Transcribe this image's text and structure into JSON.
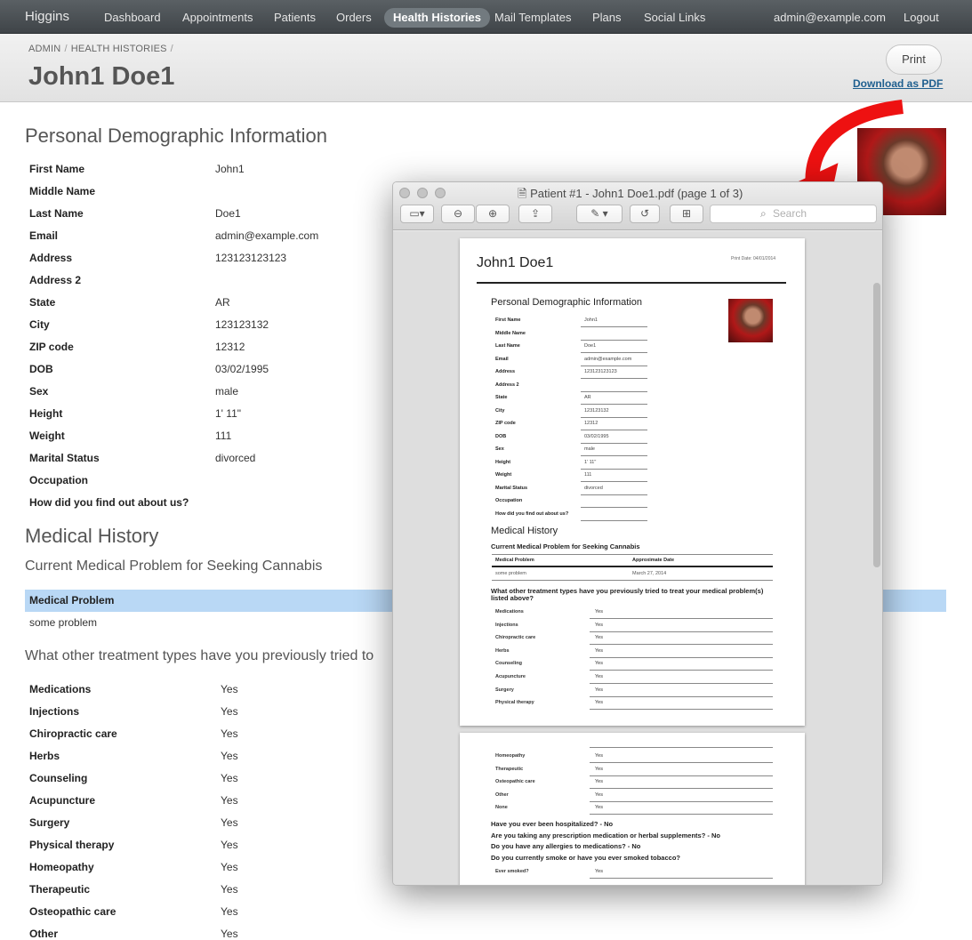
{
  "nav": {
    "brand": "Higgins",
    "items": [
      "Dashboard",
      "Appointments",
      "Patients",
      "Orders",
      "Health Histories",
      "Mail Templates",
      "Plans",
      "Social Links"
    ],
    "user": "admin@example.com",
    "logout": "Logout"
  },
  "header": {
    "breadcrumb": [
      "ADMIN",
      "HEALTH HISTORIES"
    ],
    "title": "John1 Doe1",
    "print": "Print",
    "download": "Download as PDF"
  },
  "demographics": {
    "heading": "Personal Demographic Information",
    "fields": [
      {
        "label": "First Name",
        "value": "John1"
      },
      {
        "label": "Middle Name",
        "value": ""
      },
      {
        "label": "Last Name",
        "value": "Doe1"
      },
      {
        "label": "Email",
        "value": "admin@example.com"
      },
      {
        "label": "Address",
        "value": "123123123123"
      },
      {
        "label": "Address 2",
        "value": ""
      },
      {
        "label": "State",
        "value": "AR"
      },
      {
        "label": "City",
        "value": "123123132"
      },
      {
        "label": "ZIP code",
        "value": "12312"
      },
      {
        "label": "DOB",
        "value": "03/02/1995"
      },
      {
        "label": "Sex",
        "value": "male"
      },
      {
        "label": "Height",
        "value": "1' 11\""
      },
      {
        "label": "Weight",
        "value": "111"
      },
      {
        "label": "Marital Status",
        "value": "divorced"
      },
      {
        "label": "Occupation",
        "value": ""
      },
      {
        "label": "How did you find out about us?",
        "value": ""
      }
    ]
  },
  "medical": {
    "heading": "Medical History",
    "current_problem_heading": "Current Medical Problem for Seeking Cannabis",
    "problem_col": "Medical Problem",
    "problem": "some problem",
    "treatments_heading": "What other treatment types have you previously tried to",
    "treatments": [
      {
        "label": "Medications",
        "value": "Yes"
      },
      {
        "label": "Injections",
        "value": "Yes"
      },
      {
        "label": "Chiropractic care",
        "value": "Yes"
      },
      {
        "label": "Herbs",
        "value": "Yes"
      },
      {
        "label": "Counseling",
        "value": "Yes"
      },
      {
        "label": "Acupuncture",
        "value": "Yes"
      },
      {
        "label": "Surgery",
        "value": "Yes"
      },
      {
        "label": "Physical therapy",
        "value": "Yes"
      },
      {
        "label": "Homeopathy",
        "value": "Yes"
      },
      {
        "label": "Therapeutic",
        "value": "Yes"
      },
      {
        "label": "Osteopathic care",
        "value": "Yes"
      },
      {
        "label": "Other",
        "value": "Yes"
      }
    ]
  },
  "preview": {
    "title": "Patient #1 - John1  Doe1.pdf (page 1 of 3)",
    "search_placeholder": "Search",
    "page1": {
      "title": "John1 Doe1",
      "print_date": "Print Date: 04/01/2014",
      "demo_heading": "Personal Demographic Information",
      "fields": [
        {
          "label": "First Name",
          "value": "John1"
        },
        {
          "label": "Middle Name",
          "value": ""
        },
        {
          "label": "Last Name",
          "value": "Doe1"
        },
        {
          "label": "Email",
          "value": "admin@example.com"
        },
        {
          "label": "Address",
          "value": "123123123123"
        },
        {
          "label": "Address 2",
          "value": ""
        },
        {
          "label": "State",
          "value": "AR"
        },
        {
          "label": "City",
          "value": "123123132"
        },
        {
          "label": "ZIP code",
          "value": "12312"
        },
        {
          "label": "DOB",
          "value": "03/02/1995"
        },
        {
          "label": "Sex",
          "value": "male"
        },
        {
          "label": "Height",
          "value": "1' 11\""
        },
        {
          "label": "Weight",
          "value": "111"
        },
        {
          "label": "Marital Status",
          "value": "divorced"
        },
        {
          "label": "Occupation",
          "value": ""
        },
        {
          "label": "How did you find out about us?",
          "value": ""
        }
      ],
      "med_heading": "Medical History",
      "current_heading": "Current Medical Problem for Seeking Cannabis",
      "col1": "Medical Problem",
      "col2": "Approximate Date",
      "problem": "some problem",
      "problem_date": "March 27, 2014",
      "treat_heading": "What other treatment types have you previously tried to treat your medical problem(s) listed above?",
      "treatments": [
        {
          "label": "Medications",
          "value": "Yes"
        },
        {
          "label": "Injections",
          "value": "Yes"
        },
        {
          "label": "Chiropractic care",
          "value": "Yes"
        },
        {
          "label": "Herbs",
          "value": "Yes"
        },
        {
          "label": "Counseling",
          "value": "Yes"
        },
        {
          "label": "Acupuncture",
          "value": "Yes"
        },
        {
          "label": "Surgery",
          "value": "Yes"
        },
        {
          "label": "Physical therapy",
          "value": "Yes"
        }
      ]
    },
    "page2": {
      "treatments": [
        {
          "label": "Homeopathy",
          "value": "Yes"
        },
        {
          "label": "Therapeutic",
          "value": "Yes"
        },
        {
          "label": "Osteopathic care",
          "value": "Yes"
        },
        {
          "label": "Other",
          "value": "Yes"
        },
        {
          "label": "None",
          "value": "Yes"
        }
      ],
      "questions": [
        "Have you ever been hospitalized? - No",
        "Are you taking any prescription medication or herbal supplements? - No",
        "Do you have any allergies to medications? - No",
        "Do you currently smoke or have you ever smoked tobacco?"
      ],
      "smoked_label": "Ever smoked?",
      "smoked_value": "Yes"
    }
  }
}
